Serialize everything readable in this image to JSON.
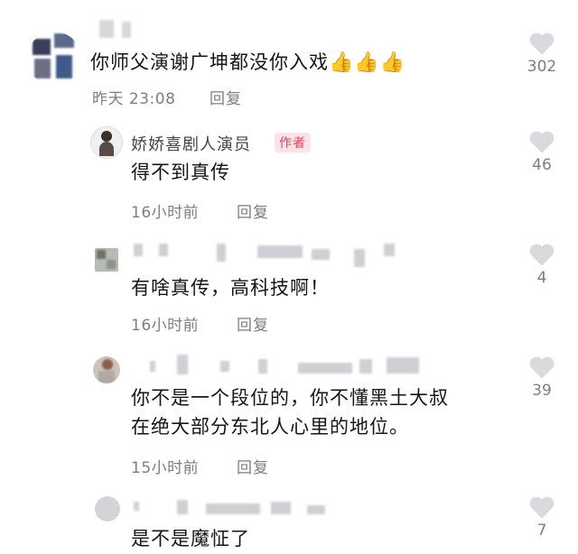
{
  "comments": [
    {
      "text": "你师父演谢广坤都没你入戏",
      "emoji": "👍👍👍",
      "time": "昨天 23:08",
      "reply": "回复",
      "likes": "302"
    },
    {
      "author": "娇娇喜剧人演员",
      "author_badge": "作者",
      "text": "得不到真传",
      "time": "16小时前",
      "reply": "回复",
      "likes": "46"
    },
    {
      "text": "有啥真传，高科技啊！",
      "time": "16小时前",
      "reply": "回复",
      "likes": "4"
    },
    {
      "text_line1": "你不是一个段位的，你不懂黑土大叔",
      "text_line2": "在绝大部分东北人心里的地位。",
      "time": "15小时前",
      "reply": "回复",
      "likes": "39"
    },
    {
      "text": "是不是魔怔了",
      "likes": "7"
    }
  ],
  "icons": {
    "like": "heart-outline-icon",
    "emoji": "thumbs-up-emoji"
  },
  "colors": {
    "badge_bg": "#fde3e7",
    "badge_text": "#ef3a5d",
    "meta": "#7d7d85",
    "heart": "#d9d9de"
  }
}
